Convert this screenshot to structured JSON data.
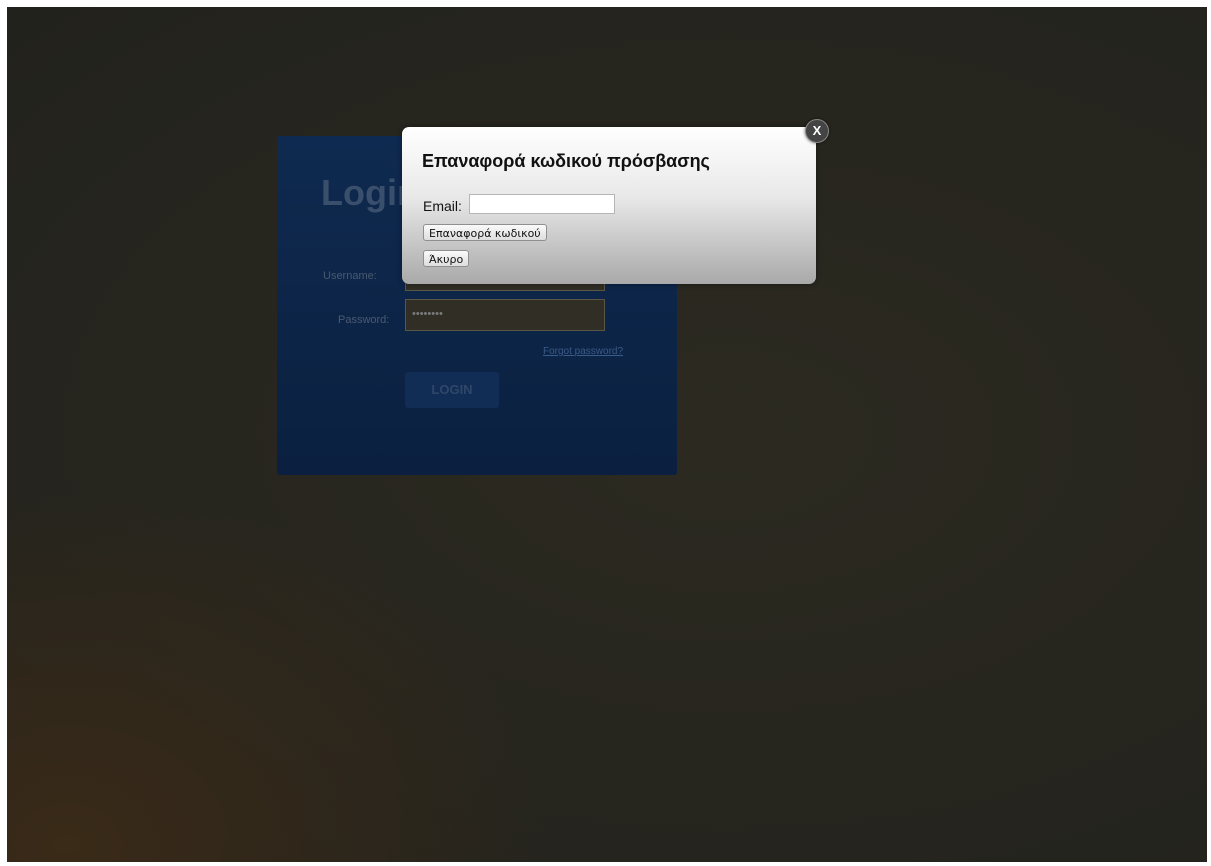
{
  "login": {
    "title": "Login",
    "username_label": "Username:",
    "password_label": "Password:",
    "password_value": "••••••••",
    "forgot_link": "Forgot password?",
    "login_button": "LOGIN"
  },
  "modal": {
    "title": "Επαναφορά κωδικού πρόσβασης",
    "email_label": "Email:",
    "email_value": "",
    "reset_button": "Επαναφορά κωδικού",
    "cancel_button": "Άκυρο",
    "close_label": "X"
  }
}
